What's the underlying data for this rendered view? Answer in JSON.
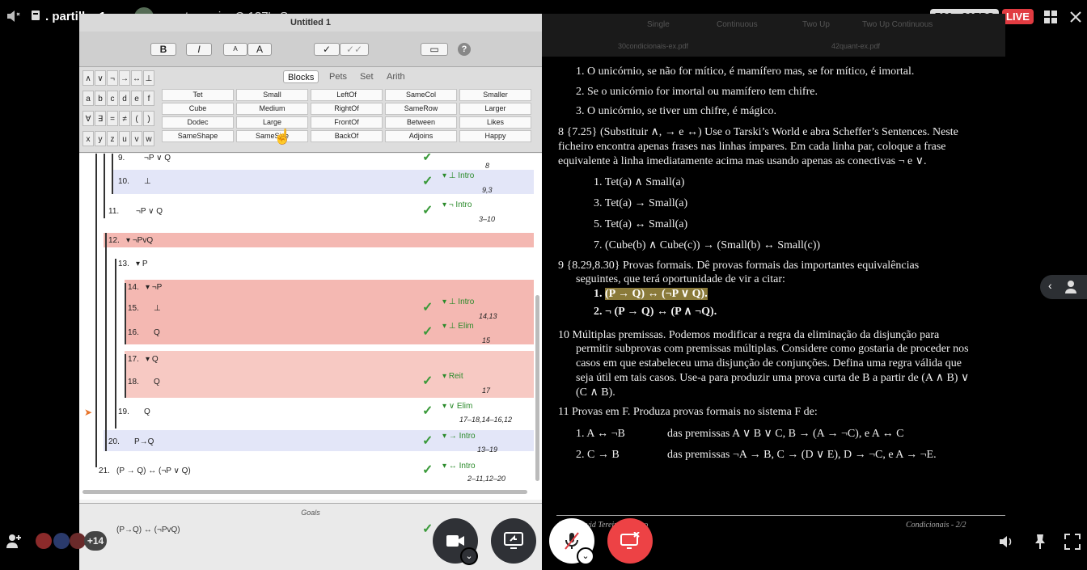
{
  "header": {
    "channel_name": ". partilha 1",
    "stream_owner": "renato soeiro C-137's Screen",
    "quality_badge": "720p 30FPS",
    "live_badge": "LIVE"
  },
  "fitch_app": {
    "window_title": "Untitled 1",
    "bold_btn": "B",
    "italic_btn": "I",
    "size_small": "A",
    "size_large": "A",
    "symbol_rows": [
      [
        "∧",
        "∨",
        "¬",
        "→",
        "↔",
        "⊥"
      ],
      [
        "a",
        "b",
        "c",
        "d",
        "e",
        "f"
      ],
      [
        "∀",
        "∃",
        "=",
        "≠",
        "(",
        ")"
      ],
      [
        "x",
        "y",
        "z",
        "u",
        "v",
        "w"
      ]
    ],
    "tabs": [
      "Blocks",
      "Pets",
      "Set",
      "Arith"
    ],
    "selected_tab": "Blocks",
    "predicates": [
      [
        "Tet",
        "Small",
        "LeftOf",
        "SameCol",
        "Smaller"
      ],
      [
        "Cube",
        "Medium",
        "RightOf",
        "SameRow",
        "Larger"
      ],
      [
        "Dodec",
        "Large",
        "FrontOf",
        "Between",
        "Likes"
      ],
      [
        "SameShape",
        "SameSize",
        "BackOf",
        "Adjoins",
        "Happy"
      ]
    ],
    "proof_lines": [
      {
        "num": "9.",
        "formula": "¬P ∨ Q",
        "rule": "",
        "cite": "8"
      },
      {
        "num": "10.",
        "formula": "⊥",
        "rule": "⊥ Intro",
        "cite": "9,3"
      },
      {
        "num": "11.",
        "formula": "¬P ∨ Q",
        "rule": "¬ Intro",
        "cite": "3–10"
      },
      {
        "num": "12.",
        "formula": "¬PvQ",
        "rule": "",
        "cite": ""
      },
      {
        "num": "13.",
        "formula": "P",
        "rule": "",
        "cite": ""
      },
      {
        "num": "14.",
        "formula": "¬P",
        "rule": "",
        "cite": ""
      },
      {
        "num": "15.",
        "formula": "⊥",
        "rule": "⊥ Intro",
        "cite": "14,13"
      },
      {
        "num": "16.",
        "formula": "Q",
        "rule": "⊥ Elim",
        "cite": "15"
      },
      {
        "num": "17.",
        "formula": "Q",
        "rule": "",
        "cite": ""
      },
      {
        "num": "18.",
        "formula": "Q",
        "rule": "Reit",
        "cite": "17"
      },
      {
        "num": "19.",
        "formula": "Q",
        "rule": "∨ Elim",
        "cite": "17–18,14–16,12"
      },
      {
        "num": "20.",
        "formula": "P→Q",
        "rule": "→ Intro",
        "cite": "13–19"
      },
      {
        "num": "21.",
        "formula": "(P → Q) ↔ (¬P ∨ Q)",
        "rule": "↔ Intro",
        "cite": "2–11,12–20"
      }
    ],
    "goals_label": "Goals",
    "goal_formula": "(P→Q) ↔ (¬PvQ)"
  },
  "pdf": {
    "tabs": [
      "Single",
      "Continuous",
      "Two Up",
      "Two Up Continuous"
    ],
    "files": [
      "30condicionais-ex.pdf",
      "42quant-ex.pdf"
    ],
    "items_top": [
      "1.  O unicórnio, se não for mítico, é mamífero mas, se for mítico, é imortal.",
      "2.  Se o unicórnio for imortal ou mamífero tem chifre.",
      "3.  O unicórnio, se tiver um chifre, é mágico."
    ],
    "q8_lines": [
      "8  {7.25} (Substituir ∧, → e ↔) Use o Tarski’s World e abra Scheffer’s Sentences. Neste",
      "ficheiro encontra apenas frases nas linhas ímpares. Em cada linha par, coloque a frase",
      "equivalente à linha imediatamente acima mas usando apenas as conectivas ¬ e ∨."
    ],
    "q8_items": [
      "1. Tet(a) ∧ Small(a)",
      "3. Tet(a) → Small(a)",
      "5. Tet(a) ↔ Small(a)",
      "7. (Cube(b) ∧ Cube(c)) → (Small(b) ↔ Small(c))"
    ],
    "q9_lines": [
      "9  {8.29,8.30} Provas formais. Dê provas formais das importantes equivalências",
      "seguintes, que terá oportunidade de vir a citar:"
    ],
    "q9_item1_num": "1.",
    "q9_item1": "(P → Q) ↔ (¬P ∨ Q).",
    "q9_item2": "2. ¬ (P → Q) ↔ (P ∧ ¬Q).",
    "q10_lines": [
      "10 Múltiplas premissas. Podemos modificar a regra da eliminação da disjunção para",
      "permitir subprovas com premissas múltiplas. Considere como gostaria de proceder nos",
      "casos em que estabeleceu uma disjunção de conjunções. Defina uma regra válida que",
      "seja útil em tais casos. Use-a para produzir uma prova curta de B a partir de (A ∧ B) ∨",
      "(C ∧ B)."
    ],
    "q11_line": "11 Provas em F. Produza provas formais no sistema F de:",
    "q11_items": [
      {
        "num": "1.",
        "goal": "A ↔ ¬B",
        "premises": "das premissas A ∨ B ∨ C, B → (A → ¬C), e A ↔ C"
      },
      {
        "num": "2.",
        "goal": "C → B",
        "premises": "das premissas ¬A → B, C → (D ∨ E), D → ¬C, e A → ¬E."
      }
    ],
    "footer_left": "Prof. David Tereina Ribeiro",
    "footer_right": "Condicionais - 2/2"
  },
  "bottom": {
    "viewer_count": "+14"
  },
  "colors": {
    "live": "#e13b41",
    "red_band": "#f4b8b2",
    "blue_band": "#e3e6f8",
    "check_green": "#3a9a3a"
  }
}
